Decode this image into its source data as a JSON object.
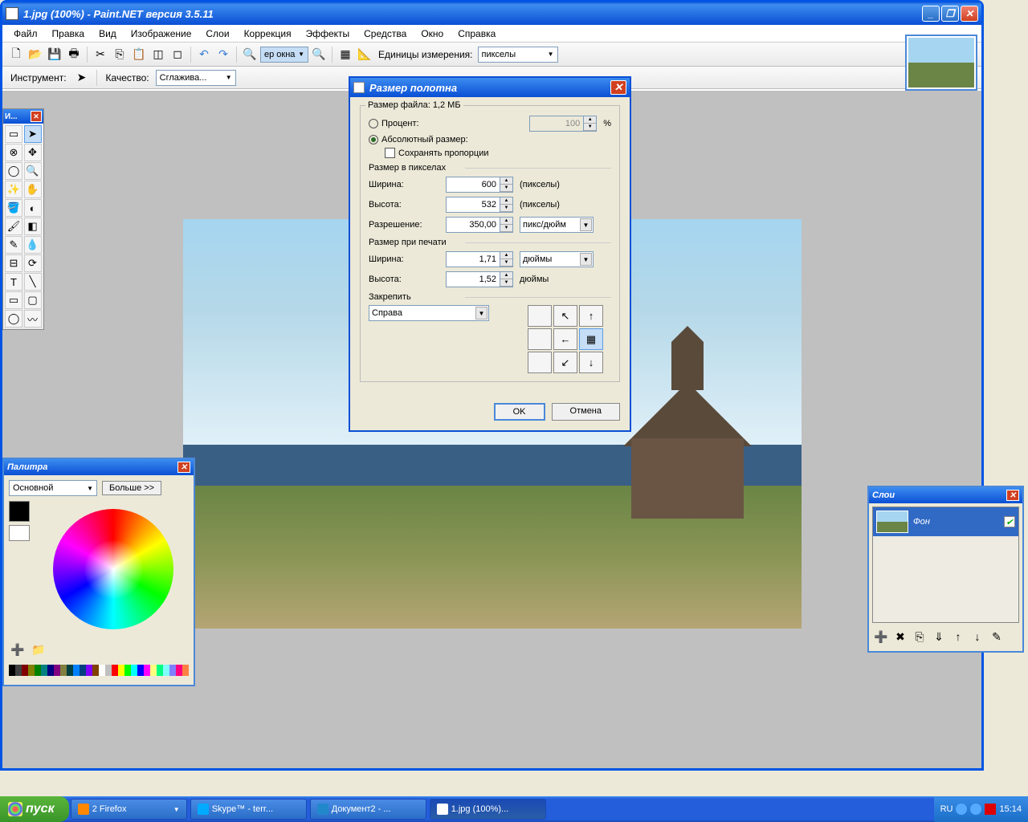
{
  "app": {
    "title": "1.jpg (100%) - Paint.NET версия 3.5.11"
  },
  "menu": [
    "Файл",
    "Правка",
    "Вид",
    "Изображение",
    "Слои",
    "Коррекция",
    "Эффекты",
    "Средства",
    "Окно",
    "Справка"
  ],
  "toolbar": {
    "zoom_combo": "ер окна",
    "units_label": "Единицы измерения:",
    "units_value": "пикселы"
  },
  "toolbar2": {
    "tool_label": "Инструмент:",
    "quality_label": "Качество:",
    "quality_value": "Сглажива..."
  },
  "tools_panel": {
    "title": "И..."
  },
  "colors_panel": {
    "title": "Палитра",
    "primary_combo": "Основной",
    "more_btn": "Больше >>"
  },
  "layers_panel": {
    "title": "Слои",
    "layer_name": "Фон"
  },
  "dialog": {
    "title": "Размер полотна",
    "filesize_label": "Размер файла: 1,2 МБ",
    "percent_label": "Процент:",
    "percent_value": "100",
    "percent_unit": "%",
    "absolute_label": "Абсолютный размер:",
    "keep_ratio": "Сохранять пропорции",
    "pixel_size_label": "Размер в пикселах",
    "width_label": "Ширина:",
    "height_label": "Высота:",
    "resolution_label": "Разрешение:",
    "width_val": "600",
    "height_val": "532",
    "resolution_val": "350,00",
    "pixels_unit": "(пикселы)",
    "res_unit": "пикс/дюйм",
    "print_size_label": "Размер при печати",
    "print_width": "1,71",
    "print_height": "1,52",
    "inches": "дюймы",
    "anchor_label": "Закрепить",
    "anchor_combo": "Справа",
    "ok": "OK",
    "cancel": "Отмена"
  },
  "taskbar": {
    "start": "пуск",
    "items": [
      "2 Firefox",
      "Skype™ - terr...",
      "Документ2 - ...",
      "1.jpg (100%)..."
    ],
    "lang": "RU",
    "time": "15:14"
  },
  "palette_colors": [
    "#000",
    "#404040",
    "#800000",
    "#808000",
    "#008000",
    "#008080",
    "#000080",
    "#800080",
    "#808040",
    "#004040",
    "#0080ff",
    "#004080",
    "#8000ff",
    "#804000",
    "#fff",
    "#c0c0c0",
    "#f00",
    "#ff0",
    "#0f0",
    "#0ff",
    "#00f",
    "#f0f",
    "#ffff80",
    "#00ff80",
    "#80ffff",
    "#8080ff",
    "#ff0080",
    "#ff8040"
  ]
}
